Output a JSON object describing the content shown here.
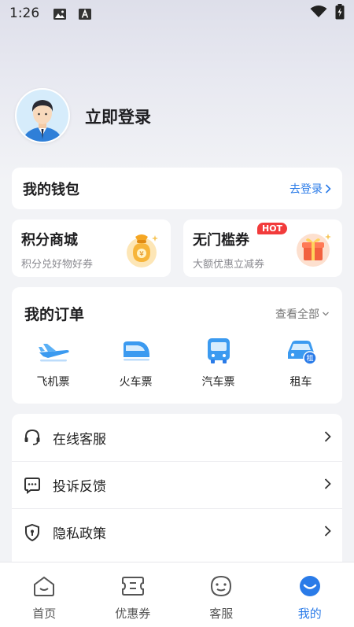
{
  "status_bar": {
    "time": "1:26"
  },
  "profile": {
    "login_text": "立即登录"
  },
  "wallet": {
    "title": "我的钱包",
    "action": "去登录"
  },
  "points_mall": {
    "title": "积分商城",
    "subtitle": "积分兑好物好券"
  },
  "no_threshold": {
    "title": "无门槛券",
    "subtitle": "大额优惠立减券",
    "badge": "HOT"
  },
  "orders": {
    "title": "我的订单",
    "view_all": "查看全部",
    "items": [
      {
        "label": "飞机票",
        "icon": "plane-icon"
      },
      {
        "label": "火车票",
        "icon": "train-icon"
      },
      {
        "label": "汽车票",
        "icon": "bus-icon"
      },
      {
        "label": "租车",
        "icon": "car-rental-icon"
      }
    ]
  },
  "menu": {
    "items": [
      {
        "label": "在线客服",
        "icon": "headset-icon"
      },
      {
        "label": "投诉反馈",
        "icon": "feedback-icon"
      },
      {
        "label": "隐私政策",
        "icon": "shield-icon"
      }
    ]
  },
  "tabbar": {
    "items": [
      {
        "label": "首页",
        "icon": "home-icon",
        "active": false
      },
      {
        "label": "优惠券",
        "icon": "coupon-icon",
        "active": false
      },
      {
        "label": "客服",
        "icon": "service-icon",
        "active": false
      },
      {
        "label": "我的",
        "icon": "profile-icon",
        "active": true
      }
    ]
  },
  "colors": {
    "accent": "#2a7be8",
    "hot_badge": "#f23b3b",
    "background": "#f2f3f6"
  }
}
